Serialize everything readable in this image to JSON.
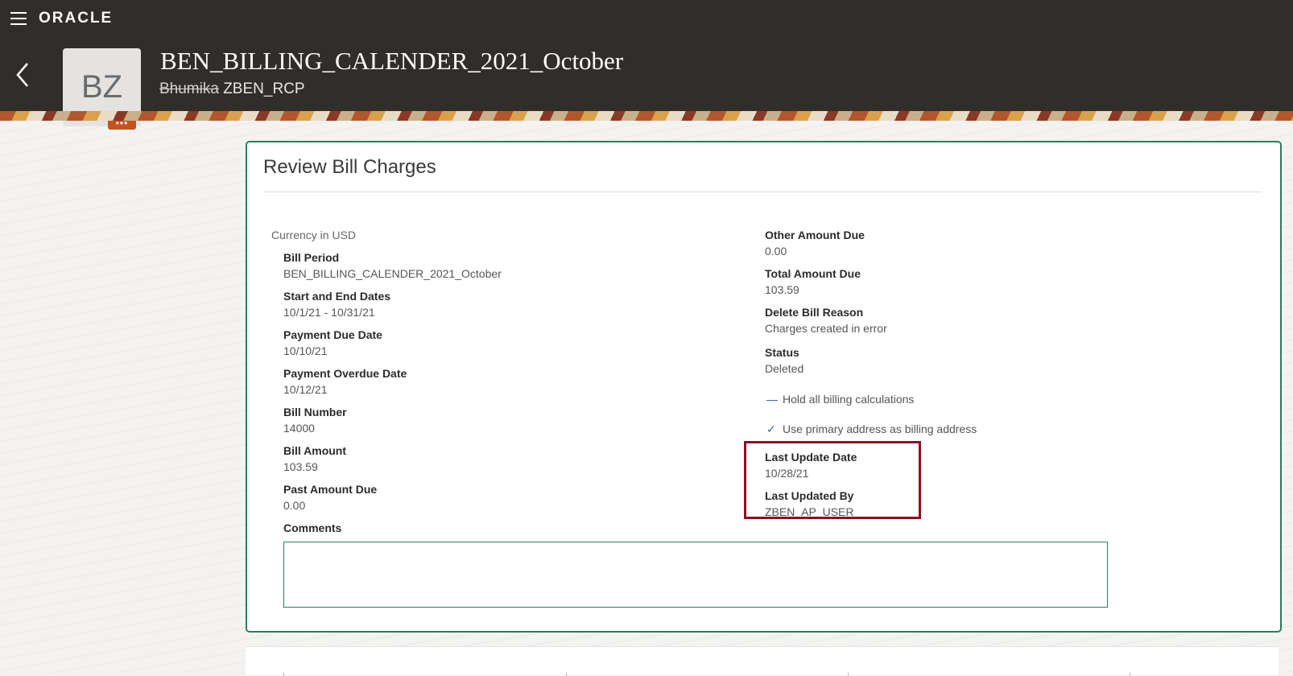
{
  "header": {
    "brand": "ORACLE",
    "title": "BEN_BILLING_CALENDER_2021_October",
    "subtitle_redacted": "Bhumika",
    "subtitle": "ZBEN_RCP",
    "avatar_initials": "BZ",
    "avatar_more": "•••"
  },
  "card": {
    "title": "Review Bill Charges",
    "currency": "Currency in USD",
    "left_fields": [
      {
        "label": "Bill Period",
        "value": "BEN_BILLING_CALENDER_2021_October"
      },
      {
        "label": "Start and End Dates",
        "value": "10/1/21 - 10/31/21"
      },
      {
        "label": "Payment Due Date",
        "value": "10/10/21"
      },
      {
        "label": "Payment Overdue Date",
        "value": "10/12/21"
      },
      {
        "label": "Bill Number",
        "value": "14000"
      },
      {
        "label": "Bill Amount",
        "value": "103.59"
      },
      {
        "label": "Past Amount Due",
        "value": "0.00"
      }
    ],
    "right_fields": [
      {
        "label": "Other Amount Due",
        "value": "0.00"
      },
      {
        "label": "Total Amount Due",
        "value": "103.59"
      },
      {
        "label": "Delete Bill Reason",
        "value": "Charges created in error"
      },
      {
        "label": "Status",
        "value": "Deleted"
      }
    ],
    "checkboxes": [
      {
        "label": "Hold all billing calculations",
        "mark": "—",
        "checked": false
      },
      {
        "label": "Use primary address as billing address",
        "mark": "✓",
        "checked": true
      }
    ],
    "last_update": [
      {
        "label": "Last Update Date",
        "value": "10/28/21"
      },
      {
        "label": "Last Updated By",
        "value": "ZBEN_AP_USER"
      }
    ],
    "comments_label": "Comments",
    "comments_value": ""
  },
  "colors": {
    "header_bg": "#312d2a",
    "card_border": "#2f7b5b",
    "highlight": "#8c1022",
    "avatar_more": "#c4521f"
  }
}
